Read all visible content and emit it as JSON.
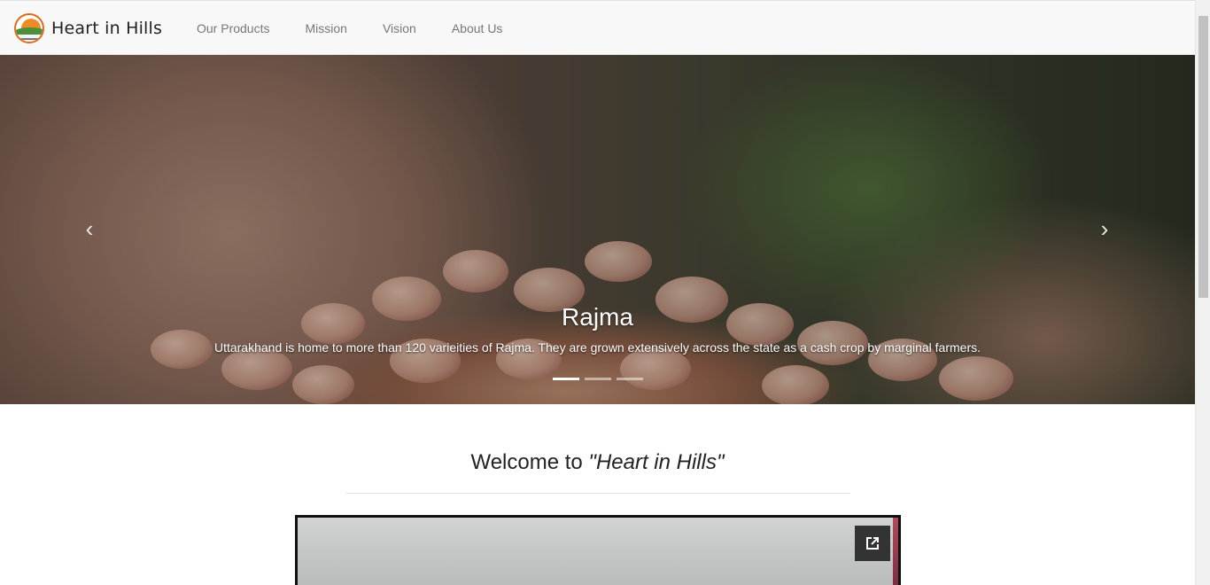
{
  "brand": {
    "name": "Heart in Hills"
  },
  "nav": {
    "items": [
      {
        "label": "Our Products"
      },
      {
        "label": "Mission"
      },
      {
        "label": "Vision"
      },
      {
        "label": "About Us"
      }
    ]
  },
  "carousel": {
    "slide_title": "Rajma",
    "slide_text": "Uttarakhand is home to more than 120 varieities of Rajma. They are grown extensively across the state as a cash crop by marginal farmers.",
    "prev_icon": "chevron-left-icon",
    "next_icon": "chevron-right-icon",
    "prev_glyph": "‹",
    "next_glyph": "›",
    "slide_count": 3,
    "active_slide": 1
  },
  "welcome": {
    "prefix": "Welcome to ",
    "name": "\"Heart in Hills\""
  },
  "video": {
    "popout_icon": "open-in-new-icon"
  }
}
